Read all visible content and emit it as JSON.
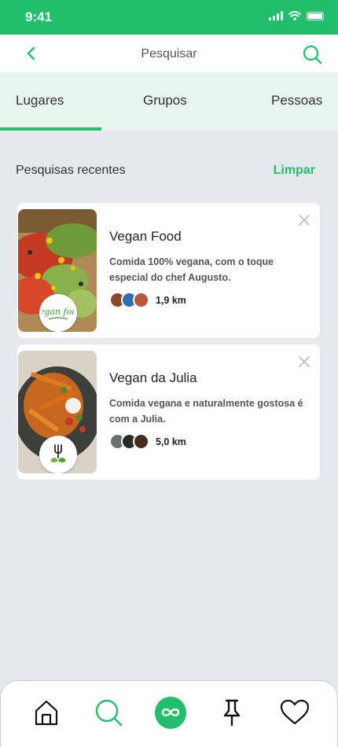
{
  "status_bar": {
    "time": "9:41"
  },
  "header": {
    "title": "Pesquisar"
  },
  "tabs": [
    {
      "label": "Lugares",
      "active": true
    },
    {
      "label": "Grupos",
      "active": false
    },
    {
      "label": "Pessoas",
      "active": false
    }
  ],
  "recent": {
    "title": "Pesquisas recentes",
    "clear_label": "Limpar"
  },
  "results": [
    {
      "name": "Vegan Food",
      "description": "Comida 100% vegana, com o toque especial do chef Augusto.",
      "distance": "1,9 km",
      "logo_text": "Vegan food"
    },
    {
      "name": "Vegan da Julia",
      "description": "Comida vegana e naturalmente gostosa é com a Julia.",
      "distance": "5,0 km"
    }
  ],
  "bottom_nav": [
    "home-icon",
    "search-icon",
    "infinity-icon",
    "pin-icon",
    "heart-icon"
  ],
  "colors": {
    "accent": "#21bf6b",
    "tab_bg": "#e6f6ee",
    "page_bg": "#e5e9ee"
  }
}
